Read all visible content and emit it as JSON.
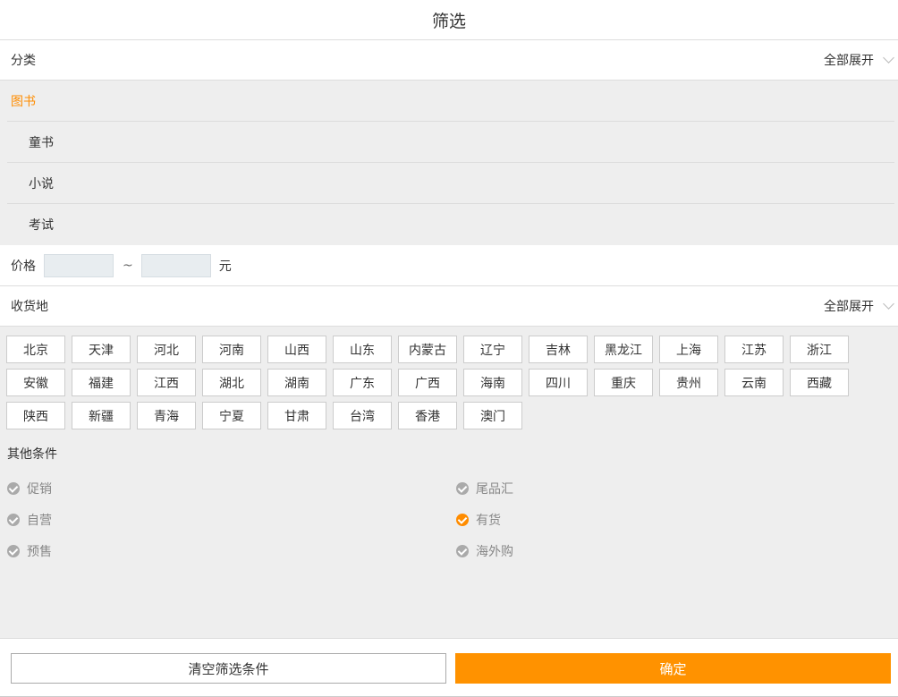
{
  "header": {
    "title": "筛选"
  },
  "category": {
    "label": "分类",
    "expand_label": "全部展开"
  },
  "categories": [
    {
      "label": "图书",
      "level": "main"
    },
    {
      "label": "童书",
      "level": "sub"
    },
    {
      "label": "小说",
      "level": "sub"
    },
    {
      "label": "考试",
      "level": "sub"
    }
  ],
  "price": {
    "label": "价格",
    "min_value": "",
    "max_value": "",
    "separator": "~",
    "unit": "元"
  },
  "delivery": {
    "label": "收货地",
    "expand_label": "全部展开"
  },
  "regions": [
    "北京",
    "天津",
    "河北",
    "河南",
    "山西",
    "山东",
    "内蒙古",
    "辽宁",
    "吉林",
    "黑龙江",
    "上海",
    "江苏",
    "浙江",
    "安徽",
    "福建",
    "江西",
    "湖北",
    "湖南",
    "广东",
    "广西",
    "海南",
    "四川",
    "重庆",
    "贵州",
    "云南",
    "西藏",
    "陕西",
    "新疆",
    "青海",
    "宁夏",
    "甘肃",
    "台湾",
    "香港",
    "澳门"
  ],
  "other": {
    "title": "其他条件",
    "conditions": [
      {
        "label": "促销",
        "checked": false
      },
      {
        "label": "尾品汇",
        "checked": false
      },
      {
        "label": "自营",
        "checked": false
      },
      {
        "label": "有货",
        "checked": true
      },
      {
        "label": "预售",
        "checked": false
      },
      {
        "label": "海外购",
        "checked": false
      }
    ]
  },
  "footer": {
    "clear_label": "清空筛选条件",
    "confirm_label": "确定"
  },
  "colors": {
    "accent": "#ff9200",
    "background": "#eeeeee"
  }
}
